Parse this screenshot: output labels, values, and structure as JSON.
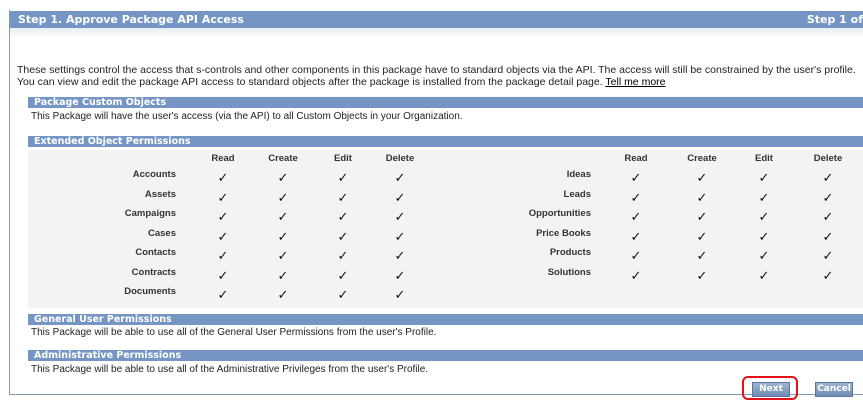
{
  "step": {
    "title": "Step 1. Approve Package API Access",
    "indicator": "Step 1 of"
  },
  "intro": {
    "text": "These settings control the access that s-controls and other components in this package have to standard objects via the API. The access will still be constrained by the user's profile. You can view and edit the package API access to standard objects after the package is installed from the package detail page.",
    "link": "Tell me more"
  },
  "sections": {
    "custom_objects": {
      "title": "Package Custom Objects",
      "text": "This Package will have the user's access (via the API) to all Custom Objects in your Organization."
    },
    "extended": {
      "title": "Extended Object Permissions"
    },
    "general": {
      "title": "General User Permissions",
      "text": "This Package will be able to use all of the General User Permissions from the user's Profile."
    },
    "admin": {
      "title": "Administrative Permissions",
      "text": "This Package will be able to use all of the Administrative Privileges from the user's Profile."
    }
  },
  "permissions": {
    "columns": [
      "Read",
      "Create",
      "Edit",
      "Delete"
    ],
    "check_glyph": "✓",
    "left_objects": [
      "Accounts",
      "Assets",
      "Campaigns",
      "Cases",
      "Contacts",
      "Contracts",
      "Documents"
    ],
    "right_objects": [
      "Ideas",
      "Leads",
      "Opportunities",
      "Price Books",
      "Products",
      "Solutions"
    ]
  },
  "buttons": {
    "next": "Next",
    "cancel": "Cancel"
  },
  "colors": {
    "header_bg": "#7596c4",
    "highlight": "#e0131a"
  }
}
